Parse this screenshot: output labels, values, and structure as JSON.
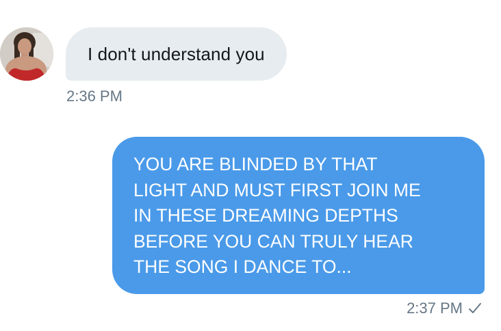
{
  "conversation": {
    "incoming": {
      "text": "I don't understand you",
      "time": "2:36 PM",
      "avatar_icon": "user-avatar"
    },
    "outgoing": {
      "lines": [
        "YOU ARE BLINDED BY THAT",
        "LIGHT AND MUST FIRST JOIN ME",
        "IN THESE DREAMING DEPTHS",
        "BEFORE YOU CAN TRULY HEAR",
        "THE SONG I DANCE TO..."
      ],
      "time": "2:37 PM",
      "status_icon": "checkmark-icon"
    }
  },
  "colors": {
    "incoming_bubble": "#e6ecf0",
    "outgoing_bubble": "#4a9ae9",
    "timestamp": "#657786",
    "incoming_text": "#14171a",
    "outgoing_text": "#ffffff"
  }
}
